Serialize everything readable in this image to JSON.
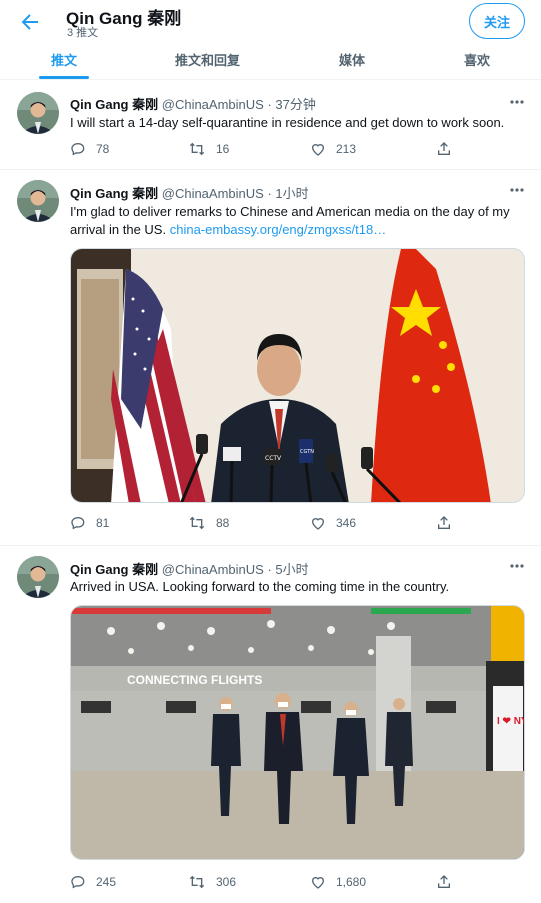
{
  "header": {
    "name": "Qin Gang 秦刚",
    "tweet_count": "3 推文",
    "follow_label": "关注"
  },
  "tabs": [
    {
      "label": "推文",
      "active": true
    },
    {
      "label": "推文和回复",
      "active": false
    },
    {
      "label": "媒体",
      "active": false
    },
    {
      "label": "喜欢",
      "active": false
    }
  ],
  "tweets": [
    {
      "name": "Qin Gang 秦刚",
      "handle": "@ChinaAmbinUS",
      "time": "· 37分钟",
      "text": "I will start a 14-day self-quarantine in residence and get down to work soon.",
      "link": "",
      "replies": "78",
      "retweets": "16",
      "likes": "213"
    },
    {
      "name": "Qin Gang 秦刚",
      "handle": "@ChinaAmbinUS",
      "time": "· 1小时",
      "text": "I'm glad to deliver remarks to Chinese and American media on the day of my arrival in the US.",
      "link": "china-embassy.org/eng/zmgxss/t18…",
      "replies": "81",
      "retweets": "88",
      "likes": "346"
    },
    {
      "name": "Qin Gang 秦刚",
      "handle": "@ChinaAmbinUS",
      "time": "· 5小时",
      "text": "Arrived in USA. Looking forward to the coming time in the country.",
      "link": "",
      "replies": "245",
      "retweets": "306",
      "likes": "1,680"
    }
  ],
  "photo_signs": {
    "connecting": "CONNECTING FLIGHTS",
    "ny": "I ❤ NY",
    "mic_cctv": "CCTV",
    "mic_cgtn": "CGTN"
  },
  "colors": {
    "accent": "#1d9bf0",
    "text": "#0f1419",
    "secondary": "#536471",
    "divider": "#eff3f4"
  },
  "icons": [
    "back-arrow-icon",
    "more-icon",
    "reply-icon",
    "retweet-icon",
    "like-icon",
    "share-icon"
  ]
}
